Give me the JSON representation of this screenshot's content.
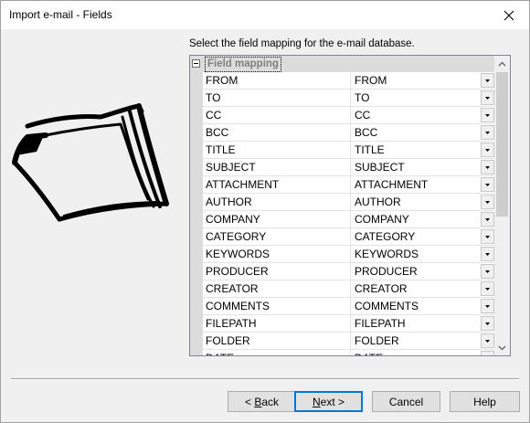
{
  "window": {
    "title": "Import e-mail - Fields",
    "close_icon": "close-icon"
  },
  "instruction": "Select the field mapping for the e-mail database.",
  "grid": {
    "category": "Field mapping",
    "rows": [
      {
        "name": "FROM",
        "value": "FROM"
      },
      {
        "name": "TO",
        "value": "TO"
      },
      {
        "name": "CC",
        "value": "CC"
      },
      {
        "name": "BCC",
        "value": "BCC"
      },
      {
        "name": "TITLE",
        "value": "TITLE"
      },
      {
        "name": "SUBJECT",
        "value": "SUBJECT"
      },
      {
        "name": "ATTACHMENT",
        "value": "ATTACHMENT"
      },
      {
        "name": "AUTHOR",
        "value": "AUTHOR"
      },
      {
        "name": "COMPANY",
        "value": "COMPANY"
      },
      {
        "name": "CATEGORY",
        "value": "CATEGORY"
      },
      {
        "name": "KEYWORDS",
        "value": "KEYWORDS"
      },
      {
        "name": "PRODUCER",
        "value": "PRODUCER"
      },
      {
        "name": "CREATOR",
        "value": "CREATOR"
      },
      {
        "name": "COMMENTS",
        "value": "COMMENTS"
      },
      {
        "name": "FILEPATH",
        "value": "FILEPATH"
      },
      {
        "name": "FOLDER",
        "value": "FOLDER"
      },
      {
        "name": "DATE",
        "value": "DATE"
      }
    ]
  },
  "buttons": {
    "back_prefix": "< ",
    "back_mnemonic": "B",
    "back_rest": "ack",
    "next_mnemonic": "N",
    "next_rest": "ext >",
    "cancel": "Cancel",
    "help": "Help"
  }
}
